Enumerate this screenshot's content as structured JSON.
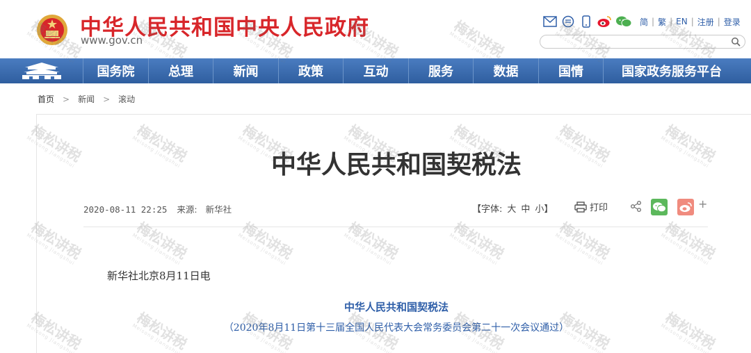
{
  "header": {
    "site_title": "中华人民共和国中央人民政府",
    "site_url": "www.gov.cn",
    "tool_icons": [
      "mail-icon",
      "message-icon",
      "mobile-icon",
      "weibo-icon",
      "wechat-icon"
    ],
    "lang_links": [
      "简",
      "繁",
      "EN",
      "注册",
      "登录"
    ],
    "search_placeholder": "",
    "colors": {
      "brand_red": "#d8262a",
      "link_blue": "#2e5ea8"
    }
  },
  "nav": {
    "home_icon": "tiananmen-icon",
    "items": [
      "国务院",
      "总理",
      "新闻",
      "政策",
      "互动",
      "服务",
      "数据",
      "国情",
      "国家政务服务平台"
    ],
    "bar_color": "#3e6fb3"
  },
  "breadcrumb": [
    "首页",
    "新闻",
    "滚动"
  ],
  "article": {
    "title": "中华人民共和国契税法",
    "datetime": "2020-08-11 22:25",
    "source_label": "来源:",
    "source": "新华社",
    "fontsize_label": "【字体:",
    "font_large": "大",
    "font_medium": "中",
    "font_small": "小】",
    "print_label": "打印",
    "more_label": "+",
    "dateline": "新华社北京8月11日电",
    "law_name": "中华人民共和国契税法",
    "law_note": "（2020年8月11日第十三届全国人民代表大会常务委员会第二十一次会议通过）"
  },
  "watermark": {
    "text": "梅松讲税",
    "sub": "Meisong Jiangshui"
  }
}
